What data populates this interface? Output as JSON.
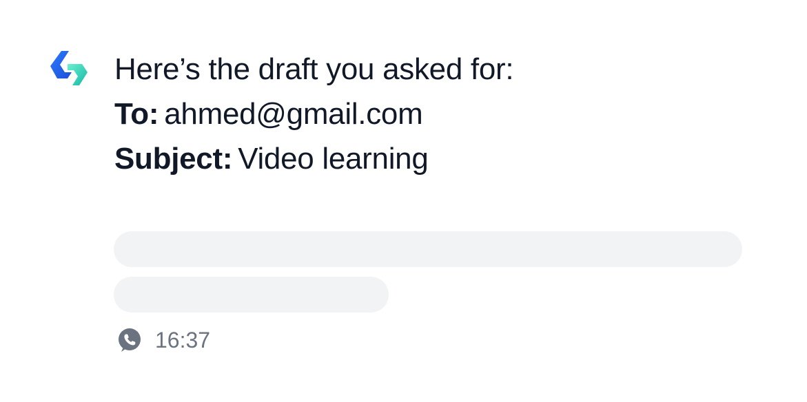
{
  "message": {
    "intro": "Here’s the draft you asked for:",
    "to_label": "To:",
    "to_value": "ahmed@gmail.com",
    "subject_label": "Subject:",
    "subject_value": "Video learning"
  },
  "footer": {
    "time": "16:37",
    "source_icon": "whatsapp-icon"
  },
  "icons": {
    "brand": "brand-logo-icon"
  },
  "colors": {
    "brand_blue": "#2563EB",
    "brand_teal": "#34D3B7",
    "skeleton": "#F2F3F5",
    "meta_gray": "#6B7280"
  }
}
